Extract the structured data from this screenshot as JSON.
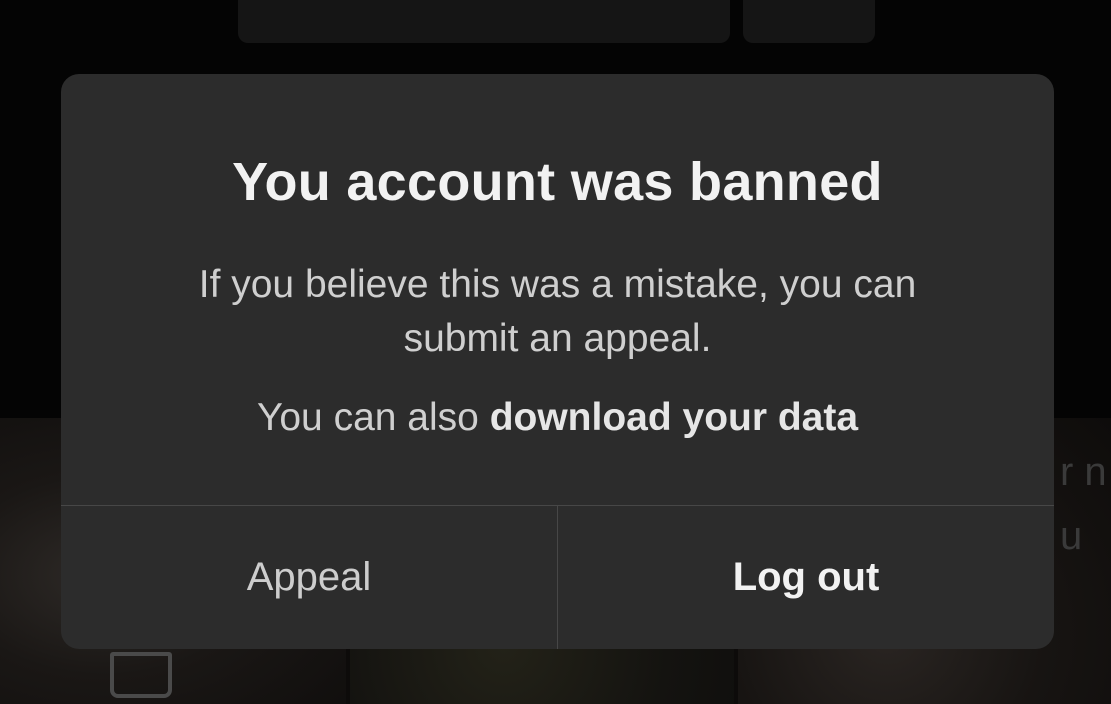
{
  "dialog": {
    "title": "You account was banned",
    "message": "If you believe this was a mistake, you can submit an appeal.",
    "download_prefix": "You can also ",
    "download_link": "download your data",
    "buttons": {
      "appeal": "Appeal",
      "logout": "Log out"
    }
  },
  "background": {
    "partial_text": "r n\nu"
  },
  "colors": {
    "dialog_bg": "#2c2c2c",
    "title": "#f2f2f2",
    "body_text": "#cfcfcf",
    "divider": "#474747",
    "backdrop": "#040404"
  },
  "icons": [
    "trash-icon"
  ]
}
